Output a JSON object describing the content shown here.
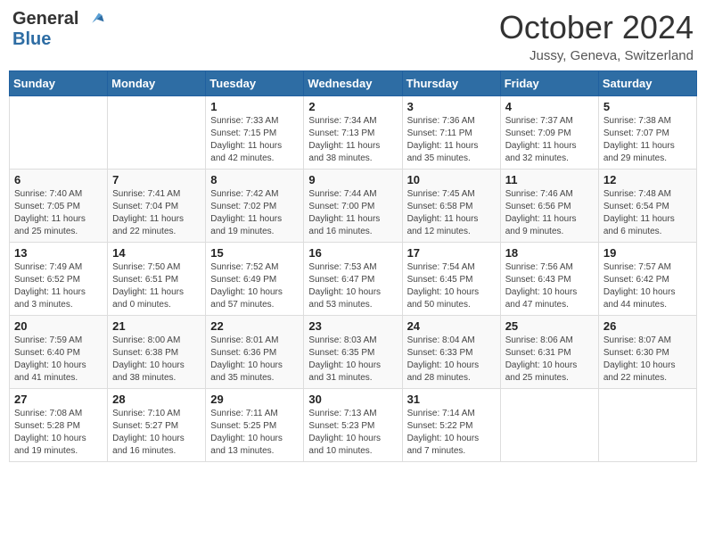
{
  "header": {
    "logo_line1": "General",
    "logo_line2": "Blue",
    "month": "October 2024",
    "location": "Jussy, Geneva, Switzerland"
  },
  "days_of_week": [
    "Sunday",
    "Monday",
    "Tuesday",
    "Wednesday",
    "Thursday",
    "Friday",
    "Saturday"
  ],
  "weeks": [
    [
      {
        "day": "",
        "info": ""
      },
      {
        "day": "",
        "info": ""
      },
      {
        "day": "1",
        "info": "Sunrise: 7:33 AM\nSunset: 7:15 PM\nDaylight: 11 hours and 42 minutes."
      },
      {
        "day": "2",
        "info": "Sunrise: 7:34 AM\nSunset: 7:13 PM\nDaylight: 11 hours and 38 minutes."
      },
      {
        "day": "3",
        "info": "Sunrise: 7:36 AM\nSunset: 7:11 PM\nDaylight: 11 hours and 35 minutes."
      },
      {
        "day": "4",
        "info": "Sunrise: 7:37 AM\nSunset: 7:09 PM\nDaylight: 11 hours and 32 minutes."
      },
      {
        "day": "5",
        "info": "Sunrise: 7:38 AM\nSunset: 7:07 PM\nDaylight: 11 hours and 29 minutes."
      }
    ],
    [
      {
        "day": "6",
        "info": "Sunrise: 7:40 AM\nSunset: 7:05 PM\nDaylight: 11 hours and 25 minutes."
      },
      {
        "day": "7",
        "info": "Sunrise: 7:41 AM\nSunset: 7:04 PM\nDaylight: 11 hours and 22 minutes."
      },
      {
        "day": "8",
        "info": "Sunrise: 7:42 AM\nSunset: 7:02 PM\nDaylight: 11 hours and 19 minutes."
      },
      {
        "day": "9",
        "info": "Sunrise: 7:44 AM\nSunset: 7:00 PM\nDaylight: 11 hours and 16 minutes."
      },
      {
        "day": "10",
        "info": "Sunrise: 7:45 AM\nSunset: 6:58 PM\nDaylight: 11 hours and 12 minutes."
      },
      {
        "day": "11",
        "info": "Sunrise: 7:46 AM\nSunset: 6:56 PM\nDaylight: 11 hours and 9 minutes."
      },
      {
        "day": "12",
        "info": "Sunrise: 7:48 AM\nSunset: 6:54 PM\nDaylight: 11 hours and 6 minutes."
      }
    ],
    [
      {
        "day": "13",
        "info": "Sunrise: 7:49 AM\nSunset: 6:52 PM\nDaylight: 11 hours and 3 minutes."
      },
      {
        "day": "14",
        "info": "Sunrise: 7:50 AM\nSunset: 6:51 PM\nDaylight: 11 hours and 0 minutes."
      },
      {
        "day": "15",
        "info": "Sunrise: 7:52 AM\nSunset: 6:49 PM\nDaylight: 10 hours and 57 minutes."
      },
      {
        "day": "16",
        "info": "Sunrise: 7:53 AM\nSunset: 6:47 PM\nDaylight: 10 hours and 53 minutes."
      },
      {
        "day": "17",
        "info": "Sunrise: 7:54 AM\nSunset: 6:45 PM\nDaylight: 10 hours and 50 minutes."
      },
      {
        "day": "18",
        "info": "Sunrise: 7:56 AM\nSunset: 6:43 PM\nDaylight: 10 hours and 47 minutes."
      },
      {
        "day": "19",
        "info": "Sunrise: 7:57 AM\nSunset: 6:42 PM\nDaylight: 10 hours and 44 minutes."
      }
    ],
    [
      {
        "day": "20",
        "info": "Sunrise: 7:59 AM\nSunset: 6:40 PM\nDaylight: 10 hours and 41 minutes."
      },
      {
        "day": "21",
        "info": "Sunrise: 8:00 AM\nSunset: 6:38 PM\nDaylight: 10 hours and 38 minutes."
      },
      {
        "day": "22",
        "info": "Sunrise: 8:01 AM\nSunset: 6:36 PM\nDaylight: 10 hours and 35 minutes."
      },
      {
        "day": "23",
        "info": "Sunrise: 8:03 AM\nSunset: 6:35 PM\nDaylight: 10 hours and 31 minutes."
      },
      {
        "day": "24",
        "info": "Sunrise: 8:04 AM\nSunset: 6:33 PM\nDaylight: 10 hours and 28 minutes."
      },
      {
        "day": "25",
        "info": "Sunrise: 8:06 AM\nSunset: 6:31 PM\nDaylight: 10 hours and 25 minutes."
      },
      {
        "day": "26",
        "info": "Sunrise: 8:07 AM\nSunset: 6:30 PM\nDaylight: 10 hours and 22 minutes."
      }
    ],
    [
      {
        "day": "27",
        "info": "Sunrise: 7:08 AM\nSunset: 5:28 PM\nDaylight: 10 hours and 19 minutes."
      },
      {
        "day": "28",
        "info": "Sunrise: 7:10 AM\nSunset: 5:27 PM\nDaylight: 10 hours and 16 minutes."
      },
      {
        "day": "29",
        "info": "Sunrise: 7:11 AM\nSunset: 5:25 PM\nDaylight: 10 hours and 13 minutes."
      },
      {
        "day": "30",
        "info": "Sunrise: 7:13 AM\nSunset: 5:23 PM\nDaylight: 10 hours and 10 minutes."
      },
      {
        "day": "31",
        "info": "Sunrise: 7:14 AM\nSunset: 5:22 PM\nDaylight: 10 hours and 7 minutes."
      },
      {
        "day": "",
        "info": ""
      },
      {
        "day": "",
        "info": ""
      }
    ]
  ]
}
